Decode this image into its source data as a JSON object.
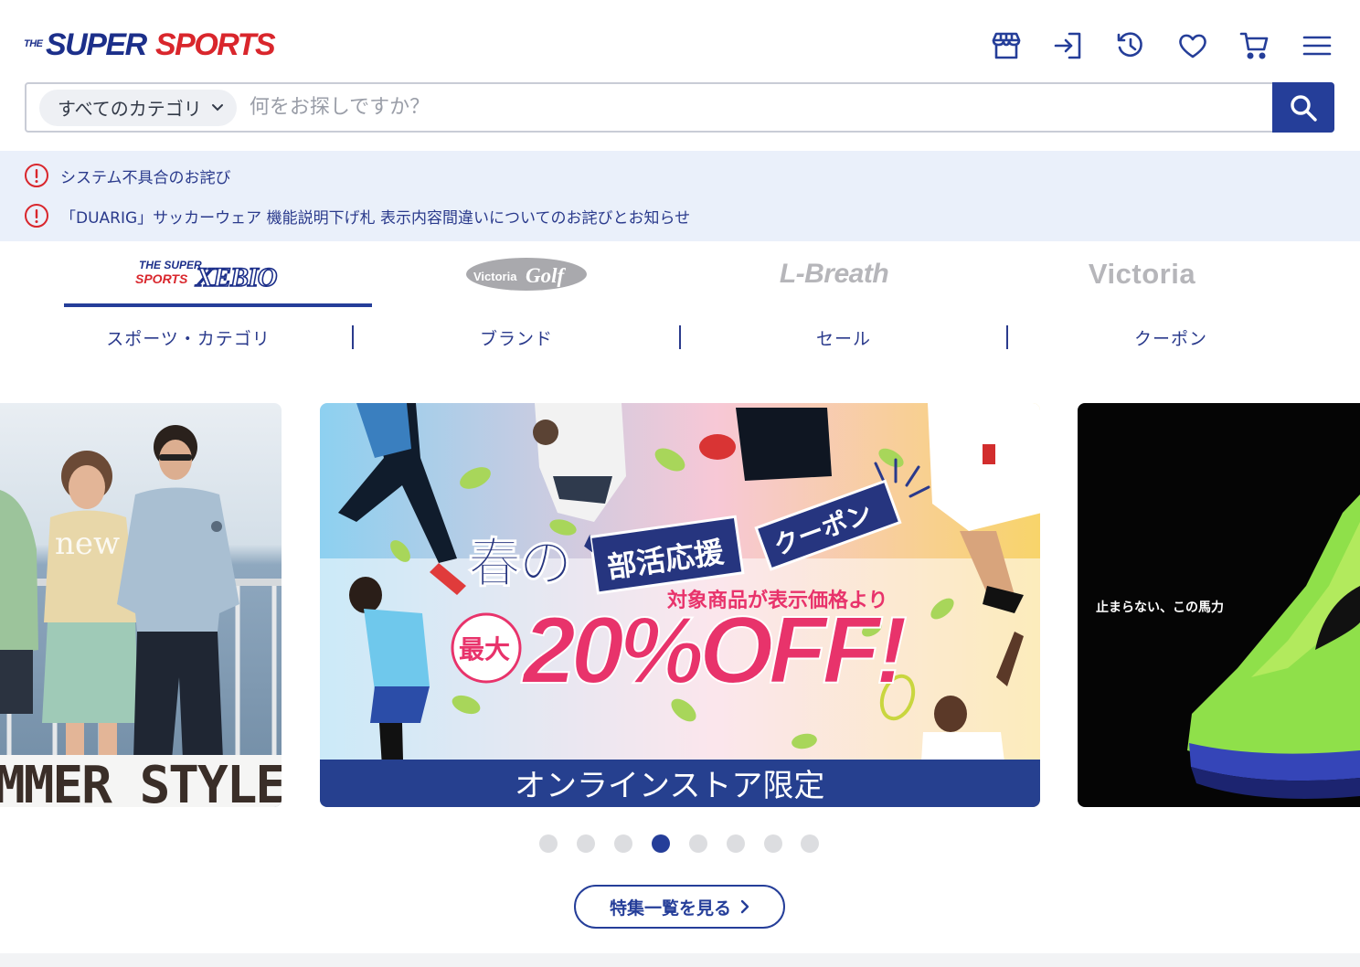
{
  "logo": {
    "the": "THE",
    "super": "SUPER",
    "sports": "SPORTS"
  },
  "header_icons": [
    "store-icon",
    "login-icon",
    "history-icon",
    "heart-icon",
    "cart-icon",
    "menu-icon"
  ],
  "search": {
    "category_label": "すべてのカテゴリ",
    "placeholder": "何をお探しですか？"
  },
  "notices": [
    {
      "text": "システム不具合のお詫び"
    },
    {
      "text": "「DUARIG」サッカーウェア 機能説明下げ札 表示内容間違いについてのお詫びとお知らせ"
    }
  ],
  "brands": {
    "xebio": {
      "top1": "THE SUPER",
      "top2": "SPORTS",
      "main": "XEBIO"
    },
    "victoria_golf": {
      "small": "Victoria",
      "main": "Golf"
    },
    "lbreath": "L-Breath",
    "victoria": "Victoria"
  },
  "subnav": [
    "スポーツ・カテゴリ",
    "ブランド",
    "セール",
    "クーポン"
  ],
  "slides": {
    "left": {
      "text": "MMER STYLE",
      "badge": "new"
    },
    "center": {
      "haru": "春の",
      "bukatsu": "部活応援",
      "coupon": "クーポン",
      "target": "対象商品が表示価格より",
      "max": "最大",
      "discount": "20%OFF!",
      "online": "オンラインストア限定"
    },
    "right": {
      "tagline": "止まらない、この馬力"
    }
  },
  "carousel": {
    "total": 8,
    "active_index": 3
  },
  "more_button": "特集一覧を見る",
  "colors": {
    "brand_blue": "#253e99",
    "brand_red": "#d9262c",
    "notice_bg": "#eaf0fa",
    "coupon_pink": "#e8336b"
  }
}
